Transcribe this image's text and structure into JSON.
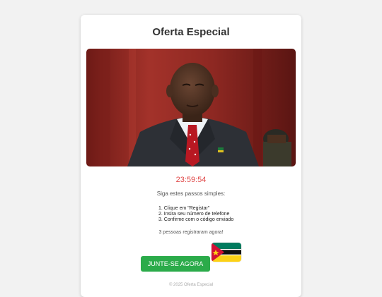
{
  "page": {
    "title": "Oferta Especial",
    "timer": "23:59:54",
    "subtitle": "Siga estes passos simples:",
    "steps": [
      "1. Clique em \"Registar\"",
      "2. Insira seu número de telefone",
      "3. Confirme com o código enviado"
    ],
    "social_proof": "3 pessoas registraram agora!",
    "cta_label": "JUNTE-SE AGORA",
    "footer": "© 2025 Oferta Especial"
  },
  "images": {
    "hero": "photo of a man in dark suit, white shirt and red polka-dot tie with lapel pin, red background",
    "flag": "Mozambique flag"
  },
  "colors": {
    "accent": "#2bab4a",
    "timer": "#e04848",
    "background": "#f2f2f2"
  }
}
